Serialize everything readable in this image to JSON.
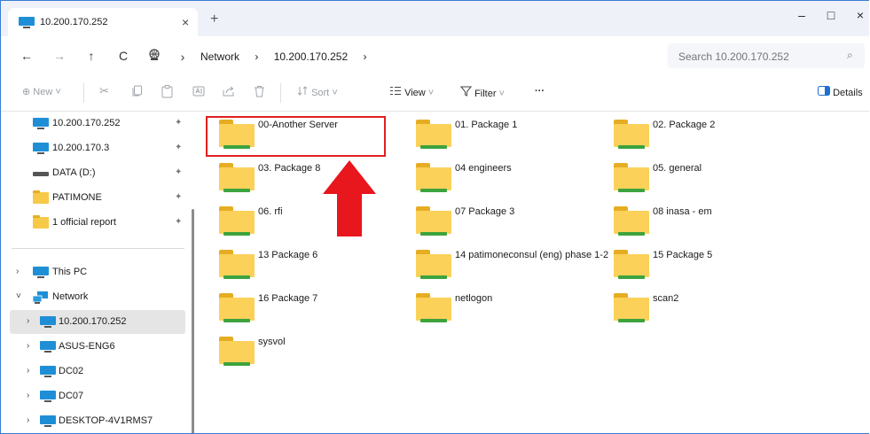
{
  "window": {
    "tab_title": "10.200.170.252",
    "tab_close": "×",
    "new_tab": "+",
    "minimize": "–",
    "maximize": "□",
    "close": "×"
  },
  "nav": {
    "back": "←",
    "forward": "→",
    "up": "↑",
    "refresh": "C",
    "location_icon": "globe-network-icon",
    "sep1": "›",
    "sep2": "›",
    "sep3": "›"
  },
  "breadcrumbs": [
    "Network",
    "10.200.170.252"
  ],
  "search": {
    "placeholder": "Search 10.200.170.252",
    "icon": "⌕"
  },
  "toolbar": {
    "new": "New",
    "sort": "Sort",
    "view": "View",
    "filter": "Filter",
    "more": "···",
    "details": "Details",
    "new_icon": "⊕",
    "cut_icon": "✂",
    "chevron": "˅"
  },
  "sidebar": {
    "pin": "📌",
    "quick_access": [
      {
        "label": "10.200.170.252",
        "icon": "monitor-icon"
      },
      {
        "label": "10.200.170.3",
        "icon": "monitor-icon"
      },
      {
        "label": "DATA (D:)",
        "icon": "drive-icon"
      },
      {
        "label": "PATIMONE",
        "icon": "folder-icon"
      },
      {
        "label": "1 official report",
        "icon": "folder-icon"
      }
    ],
    "tree": [
      {
        "label": "This PC",
        "chevron": "›"
      },
      {
        "label": "Network",
        "chevron": "˅"
      },
      {
        "label": "10.200.170.252",
        "chevron": "›",
        "selected": true
      },
      {
        "label": "ASUS-ENG6",
        "chevron": "›"
      },
      {
        "label": "DC02",
        "chevron": "›"
      },
      {
        "label": "DC07",
        "chevron": "›"
      },
      {
        "label": "DESKTOP-4V1RMS7",
        "chevron": "›"
      }
    ]
  },
  "folders": [
    "00-Another Server",
    "01. Package 1",
    "02. Package 2",
    "03. Package 8",
    "04 engineers",
    "05. general",
    "06. rfi",
    "07 Package 3",
    "08 inasa - em",
    "13 Package 6",
    "14 patimoneconsul (eng) phase 1-2",
    "15 Package 5",
    "16 Package 7",
    "netlogon",
    "scan2",
    "sysvol"
  ],
  "colors": {
    "highlight": "#e02020",
    "arrow": "#e8161d",
    "folder": "#fbd15a",
    "share_bar": "#3da33d",
    "monitor": "#1e8fd6"
  }
}
